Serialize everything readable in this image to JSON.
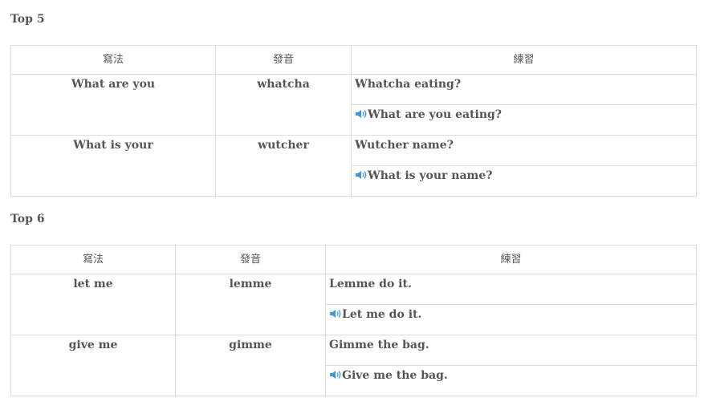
{
  "sections": [
    {
      "title": "Top 5",
      "headers": [
        "寫法",
        "發音",
        "練習"
      ],
      "rows": [
        {
          "word": "What are you",
          "pron": "whatcha",
          "example": "Whatcha eating?",
          "audio_example": "What are you eating?"
        },
        {
          "word": "What is your",
          "pron": "wutcher",
          "example": "Wutcher name?",
          "audio_example": "What is your name?"
        }
      ]
    },
    {
      "title": "Top 6",
      "headers": [
        "寫法",
        "發音",
        "練習"
      ],
      "rows": [
        {
          "word": "let me",
          "pron": "lemme",
          "example": "Lemme do it.",
          "audio_example": "Let me do it."
        },
        {
          "word": "give me",
          "pron": "gimme",
          "example": "Gimme the bag.",
          "audio_example": "Give me the bag."
        }
      ]
    }
  ],
  "icons": {
    "speaker": "speaker-icon"
  },
  "colors": {
    "text": "#555555",
    "border": "#dddddd",
    "speaker": "#3a9ad9"
  }
}
